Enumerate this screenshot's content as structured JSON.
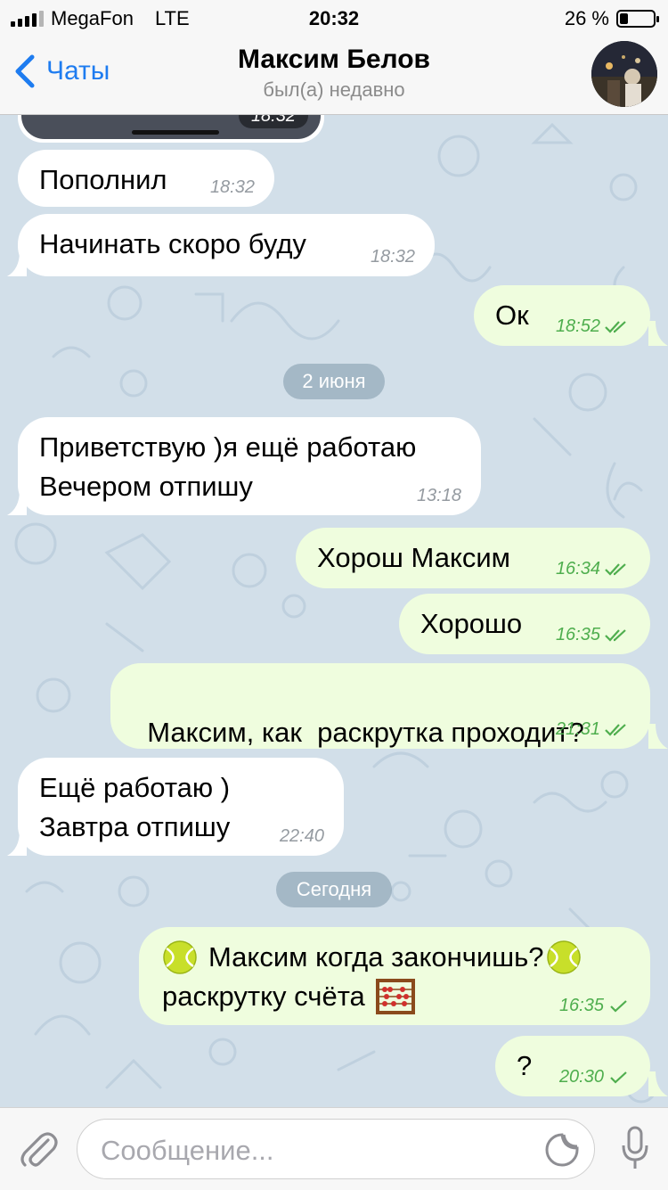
{
  "status_bar": {
    "carrier": "MegaFon",
    "network": "LTE",
    "time": "20:32",
    "battery_text": "26 %",
    "battery_level": 0.26
  },
  "header": {
    "back_label": "Чаты",
    "title": "Максим Белов",
    "subtitle": "был(а) недавно"
  },
  "messages": [
    {
      "direction": "in",
      "time": "18:32",
      "kind": "photo"
    },
    {
      "direction": "in",
      "text": "Пополнил",
      "time": "18:32"
    },
    {
      "direction": "in",
      "text": "Начинать скоро буду",
      "time": "18:32"
    },
    {
      "direction": "out",
      "text": "Ок",
      "time": "18:52",
      "status": "read"
    },
    {
      "date_separator": "2 июня"
    },
    {
      "direction": "in",
      "lines": [
        "Приветствую )я ещё работаю",
        "Вечером отпишу"
      ],
      "time": "13:18"
    },
    {
      "direction": "out",
      "text": "Хорош Максим",
      "time": "16:34",
      "status": "read"
    },
    {
      "direction": "out",
      "text": "Хорошо",
      "time": "16:35",
      "status": "read"
    },
    {
      "direction": "out",
      "text": "Максим, как  раскрутка проходит?",
      "time": "21:31",
      "status": "read"
    },
    {
      "direction": "in",
      "lines": [
        "Ещё работаю )",
        "Завтра отпишу"
      ],
      "time": "22:40"
    },
    {
      "date_separator": "Сегодня"
    },
    {
      "direction": "out",
      "line1": "Максим когда закончишь?",
      "line2": "раскрутку счёта",
      "time": "16:35",
      "status": "sent",
      "emoji": [
        "tennis-ball",
        "tennis-ball",
        "abacus"
      ]
    },
    {
      "direction": "out",
      "text": "?",
      "time": "20:30",
      "status": "sent"
    }
  ],
  "input": {
    "placeholder": "Сообщение..."
  },
  "colors": {
    "accent": "#1e7cf0",
    "incoming_bubble": "#ffffff",
    "outgoing_bubble": "#effdde",
    "time_green": "#4fae4e",
    "chat_background": "#d2dfe9"
  },
  "icons": [
    "back-chevron-icon",
    "paperclip-icon",
    "sticker-icon",
    "microphone-icon",
    "double-check-icon",
    "single-check-icon"
  ]
}
